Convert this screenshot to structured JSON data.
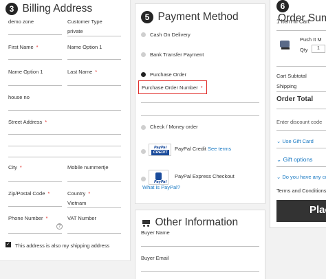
{
  "billing": {
    "step": "3",
    "title": "Billing Address",
    "fields": {
      "demo_zone": "demo zone",
      "customer_type": "Customer Type",
      "customer_type_value": "private",
      "first_name": "First Name",
      "name_option_1a": "Name Option 1",
      "name_option_1b": "Name Option 1",
      "last_name": "Last Name",
      "house_no": "house no",
      "street_address": "Street Address",
      "city": "City",
      "mobile": "Mobile nummertje",
      "zip": "Zip/Postal Code",
      "country": "Country",
      "country_value": "Vietnam",
      "phone": "Phone Number",
      "vat": "VAT Number"
    },
    "required_mark": "*",
    "help_glyph": "?",
    "same_address_label": "This address is also my shipping address"
  },
  "payment": {
    "step": "5",
    "title": "Payment Method",
    "options": {
      "cod": "Cash On Delivery",
      "bank": "Bank Transfer Payment",
      "po": "Purchase Order",
      "po_field": "Purchase Order Number",
      "check": "Check / Money order",
      "paypal_credit": "PayPal Credit",
      "see_terms": "See terms",
      "paypal_express": "PayPal Express Checkout",
      "what_is_paypal": "What is PayPal?"
    },
    "badges": {
      "credit_top": "PayPal",
      "credit_bottom": "CREDIT",
      "express": "PayPal"
    }
  },
  "other": {
    "title": "Other Information",
    "buyer_name": "Buyer Name",
    "buyer_email": "Buyer Email"
  },
  "summary": {
    "step": "6",
    "title": "Order Sum",
    "items_in_cart": "1 Item in Cart",
    "item_name": "Push It M",
    "qty_label": "Qty",
    "qty_value": "1",
    "cart_subtotal": "Cart Subtotal",
    "shipping": "Shipping",
    "order_total": "Order Total",
    "discount_placeholder": "Enter discount code",
    "gift_card": "Use Gift Card",
    "gift_options": "Gift options",
    "have_any": "Do you have any co",
    "terms": "Terms and Conditions",
    "place_order": "Plac"
  },
  "colors": {
    "accent_link": "#1979c3",
    "required": "#e02b27",
    "place_order_bg": "#333333",
    "highlight_border": "#e02b27"
  }
}
